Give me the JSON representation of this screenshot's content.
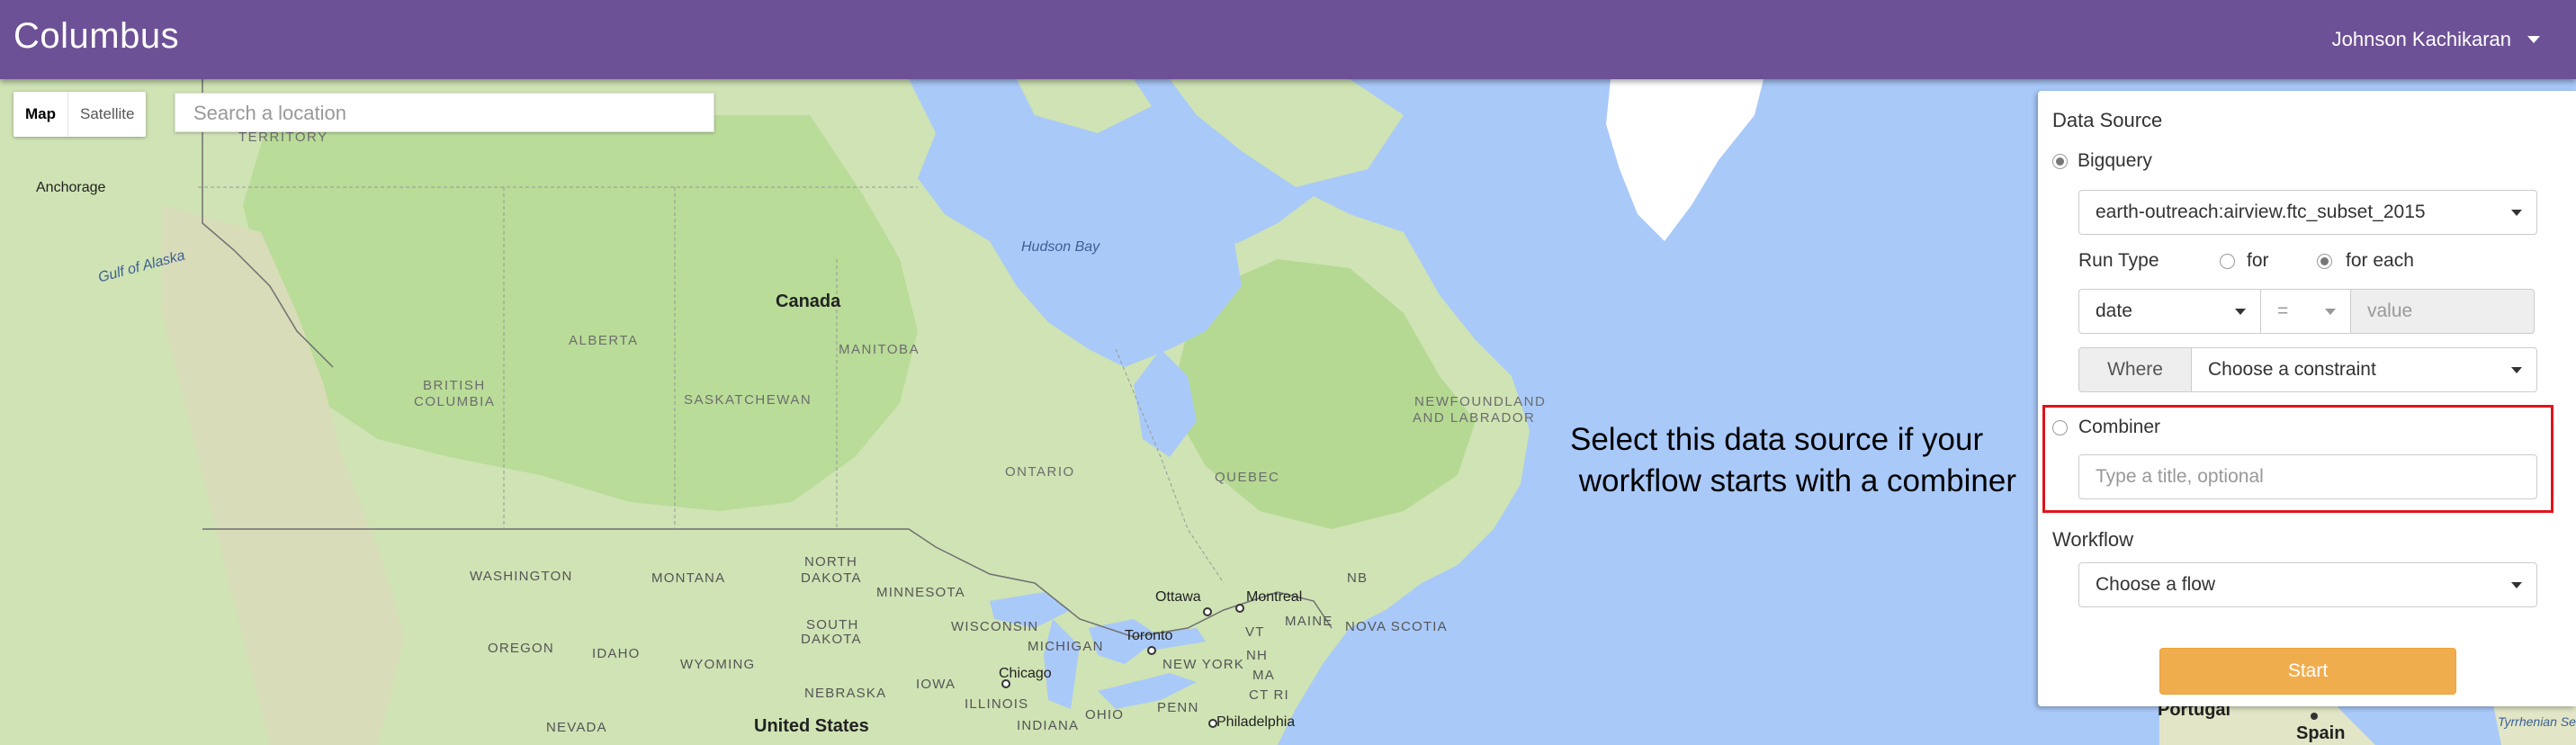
{
  "header": {
    "title": "Columbus",
    "user_name": "Johnson Kachikaran"
  },
  "map_controls": {
    "map_label": "Map",
    "satellite_label": "Satellite",
    "search_placeholder": "Search a location"
  },
  "map_labels": {
    "territory": "TERRITORY",
    "anchorage": "Anchorage",
    "gulf_of_alaska": "Gulf of Alaska",
    "hudson_bay": "Hudson Bay",
    "canada": "Canada",
    "alberta": "ALBERTA",
    "manitoba": "MANITOBA",
    "british": "BRITISH",
    "columbia": "COLUMBIA",
    "saskatchewan": "SASKATCHEWAN",
    "newfoundland": "NEWFOUNDLAND",
    "and_labrador": "AND LABRADOR",
    "ontario": "ONTARIO",
    "quebec": "QUEBEC",
    "washington": "WASHINGTON",
    "montana": "MONTANA",
    "north": "NORTH",
    "dakota": "DAKOTA",
    "minnesota": "MINNESOTA",
    "ottawa": "Ottawa",
    "montreal": "Montreal",
    "nb": "NB",
    "oregon": "OREGON",
    "idaho": "IDAHO",
    "wyoming": "WYOMING",
    "south": "SOUTH",
    "dakota2": "DAKOTA",
    "wisconsin": "WISCONSIN",
    "michigan": "MICHIGAN",
    "toronto": "Toronto",
    "vt": "VT",
    "maine": "MAINE",
    "nova_scotia": "NOVA SCOTIA",
    "new_york": "NEW YORK",
    "nh": "NH",
    "ma": "MA",
    "ctri": "CT RI",
    "iowa": "IOWA",
    "nebraska": "NEBRASKA",
    "chicago": "Chicago",
    "nevada": "NEVADA",
    "united_states": "United States",
    "illinois": "ILLINOIS",
    "indiana": "INDIANA",
    "ohio": "OHIO",
    "penn": "PENN",
    "philadelphia": "Philadelphia",
    "portugal": "Portugal",
    "spain": "Spain",
    "tyrrhenian": "Tyrrhenian Se"
  },
  "annotation": {
    "line1": "Select this data source if your",
    "line2": " workflow starts with a combiner"
  },
  "panel": {
    "data_source_title": "Data Source",
    "bigquery_label": "Bigquery",
    "bigquery_selected": true,
    "table_value": "earth-outreach:airview.ftc_subset_2015",
    "run_type_label": "Run Type",
    "run_type_for": "for",
    "run_type_for_each": "for each",
    "run_type_selected": "for each",
    "field_value": "date",
    "operator_value": "=",
    "value_placeholder": "value",
    "where_label": "Where",
    "constraint_value": "Choose a constraint",
    "combiner_label": "Combiner",
    "combiner_selected": false,
    "combiner_placeholder": "Type a title, optional",
    "workflow_title": "Workflow",
    "flow_value": "Choose a flow",
    "start_label": "Start"
  }
}
